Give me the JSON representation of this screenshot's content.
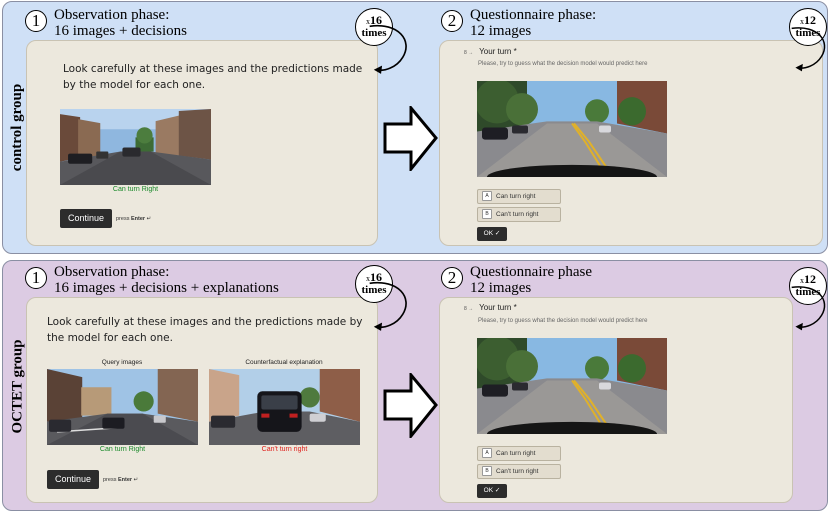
{
  "control": {
    "label": "control group",
    "obs": {
      "num": "1",
      "title_line1": "Observation phase:",
      "title_line2": "16 images + decisions",
      "times_x": "x",
      "times_count": "16",
      "times_word": "times",
      "instruction": "Look carefully at these images and the predictions made by the model for each one.",
      "prediction": "Can turn Right",
      "continue": "Continue",
      "press_prefix": "press",
      "press_key": "Enter",
      "press_suffix": "↵"
    },
    "quest": {
      "num": "2",
      "title_line1": "Questionnaire phase:",
      "title_line2": "12 images",
      "times_x": "x",
      "times_count": "12",
      "times_word": "times",
      "q_arrow": "8 →",
      "q_title": "Your turn *",
      "q_hint": "Please, try to guess what the decision model would predict here",
      "choice_a_key": "A",
      "choice_a": "Can turn right",
      "choice_b_key": "B",
      "choice_b": "Can't turn right",
      "ok": "OK ✓"
    }
  },
  "octet": {
    "label": "OCTET group",
    "obs": {
      "num": "1",
      "title_line1": "Observation phase:",
      "title_line2": "16 images + decisions + explanations",
      "times_x": "x",
      "times_count": "16",
      "times_word": "times",
      "instruction": "Look carefully at these images and the predictions made by the model for each one.",
      "query_caption": "Query images",
      "cf_caption": "Counterfactual explanation",
      "query_prediction": "Can turn Right",
      "cf_prediction": "Can't turn right",
      "continue": "Continue",
      "press_prefix": "press",
      "press_key": "Enter",
      "press_suffix": "↵"
    },
    "quest": {
      "num": "2",
      "title_line1": "Questionnaire phase",
      "title_line2": "12 images",
      "times_x": "x",
      "times_count": "12",
      "times_word": "times",
      "q_arrow": "8 →",
      "q_title": "Your turn *",
      "q_hint": "Please, try to guess what the decision model would predict here",
      "choice_a_key": "A",
      "choice_a": "Can turn right",
      "choice_b_key": "B",
      "choice_b": "Can't turn right",
      "ok": "OK ✓"
    }
  },
  "colors": {
    "control_bg": "#cfe0f6",
    "octet_bg": "#dccbe3",
    "card_bg": "#ece8dd",
    "pred_positive": "#1a8a2a",
    "pred_negative": "#e0201c"
  },
  "icons": [
    "right-arrow-icon",
    "loop-arrow-icon",
    "checkmark-icon"
  ]
}
